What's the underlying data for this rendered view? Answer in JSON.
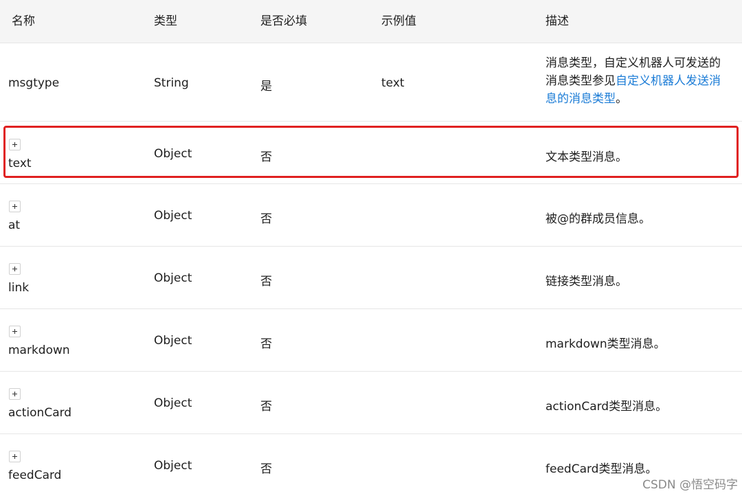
{
  "table": {
    "headers": {
      "name": "名称",
      "type": "类型",
      "required": "是否必填",
      "example": "示例值",
      "description": "描述"
    },
    "rows": [
      {
        "name": "msgtype",
        "type": "String",
        "required": "是",
        "example": "text",
        "desc_prefix": "消息类型，自定义机器人可发送的消息类型参见",
        "desc_link": "自定义机器人发送消息的消息类型",
        "desc_suffix": "。"
      },
      {
        "name": "text",
        "type": "Object",
        "required": "否",
        "example": "",
        "description": "文本类型消息。",
        "expand": "+"
      },
      {
        "name": "at",
        "type": "Object",
        "required": "否",
        "example": "",
        "description": "被@的群成员信息。",
        "expand": "+"
      },
      {
        "name": "link",
        "type": "Object",
        "required": "否",
        "example": "",
        "description": "链接类型消息。",
        "expand": "+"
      },
      {
        "name": "markdown",
        "type": "Object",
        "required": "否",
        "example": "",
        "description": "markdown类型消息。",
        "expand": "+"
      },
      {
        "name": "actionCard",
        "type": "Object",
        "required": "否",
        "example": "",
        "description": "actionCard类型消息。",
        "expand": "+"
      },
      {
        "name": "feedCard",
        "type": "Object",
        "required": "否",
        "example": "",
        "description": "feedCard类型消息。",
        "expand": "+"
      }
    ]
  },
  "highlight": {
    "color": "#e02020",
    "row": "text"
  },
  "link_color": "#1a7bd6",
  "watermark": "CSDN @悟空码字"
}
